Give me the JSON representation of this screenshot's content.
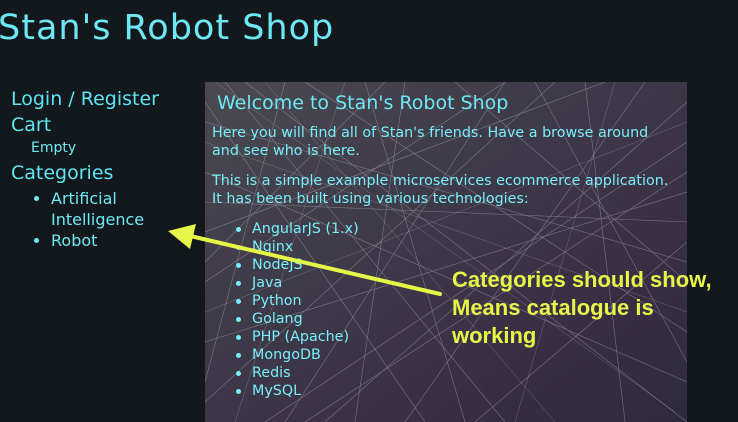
{
  "site": {
    "title": "Stan's Robot Shop"
  },
  "sidebar": {
    "login_label": "Login / Register",
    "cart_label": "Cart",
    "cart_status": "Empty",
    "categories_label": "Categories",
    "categories": [
      "Artificial Intelligence",
      "Robot"
    ]
  },
  "main": {
    "heading": "Welcome to Stan's Robot Shop",
    "intro": "Here you will find all of Stan's friends. Have a browse around and see who is here.",
    "description": "This is a simple example microservices ecommerce application. It has been built using various technologies:",
    "technologies": [
      "AngularJS (1.x)",
      "Nginx",
      "NodeJS",
      "Java",
      "Python",
      "Golang",
      "PHP (Apache)",
      "MongoDB",
      "Redis",
      "MySQL"
    ]
  },
  "annotation": {
    "text": "Categories should show, Means catalogue is working",
    "color": "#e6f547"
  }
}
